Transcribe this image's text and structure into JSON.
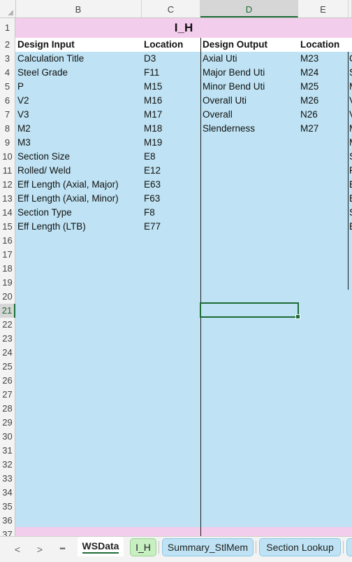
{
  "columns": [
    "B",
    "C",
    "D",
    "E"
  ],
  "selected_column": "D",
  "rows": [
    "1",
    "2",
    "3",
    "4",
    "5",
    "6",
    "7",
    "8",
    "9",
    "10",
    "11",
    "12",
    "13",
    "14",
    "15",
    "16",
    "17",
    "18",
    "19",
    "20",
    "21",
    "22",
    "23",
    "24",
    "25",
    "26",
    "27",
    "28",
    "29",
    "30",
    "31",
    "32",
    "33",
    "34",
    "35",
    "36",
    "37"
  ],
  "selected_row": "21",
  "sheet_title": "I_H",
  "headers": {
    "design_input": "Design Input",
    "location1": "Location",
    "design_output": "Design Output",
    "location2": "Location"
  },
  "inputs": [
    {
      "name": "Calculation Title",
      "loc": "D3"
    },
    {
      "name": "Steel Grade",
      "loc": "F11"
    },
    {
      "name": "P",
      "loc": "M15"
    },
    {
      "name": "V2",
      "loc": "M16"
    },
    {
      "name": "V3",
      "loc": "M17"
    },
    {
      "name": "M2",
      "loc": "M18"
    },
    {
      "name": "M3",
      "loc": "M19"
    },
    {
      "name": "Section Size",
      "loc": "E8"
    },
    {
      "name": "Rolled/ Weld",
      "loc": "E12"
    },
    {
      "name": "Eff Length (Axial, Major)",
      "loc": "E63"
    },
    {
      "name": "Eff Length (Axial, Minor)",
      "loc": "F63"
    },
    {
      "name": "Section Type",
      "loc": "F8"
    },
    {
      "name": "Eff Length (LTB)",
      "loc": "E77"
    }
  ],
  "outputs": [
    {
      "name": "Axial Uti",
      "loc": "M23"
    },
    {
      "name": "Major Bend Uti",
      "loc": "M24"
    },
    {
      "name": "Minor Bend Uti",
      "loc": "M25"
    },
    {
      "name": "Overall Uti",
      "loc": "M26"
    },
    {
      "name": "Overall",
      "loc": "N26"
    },
    {
      "name": "Slenderness",
      "loc": "M27"
    }
  ],
  "right_edge_letters": [
    "C",
    "S",
    "M",
    "V",
    "V",
    "M",
    "M",
    "S",
    "R",
    "E",
    "E",
    "S",
    "E"
  ],
  "tabs": {
    "nav_prev": "<",
    "nav_next": ">",
    "nav_more": "•••",
    "active": "WSData",
    "sheets": [
      "I_H",
      "Summary_StlMem",
      "Section Lookup"
    ]
  },
  "colors": {
    "cell_fill": "#bfe3f4",
    "title_fill": "#f3cdec",
    "accent": "#1e6b36",
    "tab_green": "#c7efc1",
    "tab_blue": "#bfe3f4"
  }
}
